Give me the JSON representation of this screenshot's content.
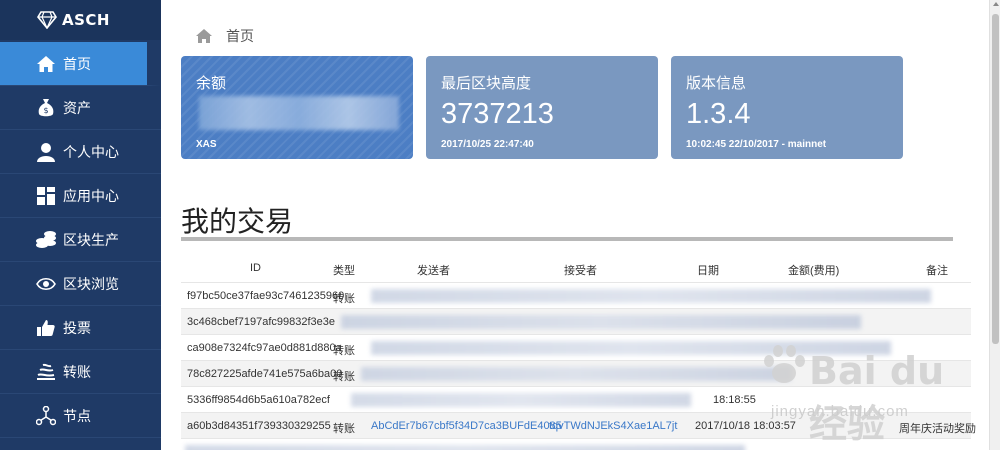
{
  "brand": {
    "name": "ASCH",
    "icon": "diamond-icon"
  },
  "sidebar": {
    "items": [
      {
        "label": "首页",
        "icon": "home-icon",
        "active": true
      },
      {
        "label": "资产",
        "icon": "money-bag-icon"
      },
      {
        "label": "个人中心",
        "icon": "user-icon"
      },
      {
        "label": "应用中心",
        "icon": "apps-grid-icon"
      },
      {
        "label": "区块生产",
        "icon": "coins-stack-icon"
      },
      {
        "label": "区块浏览",
        "icon": "eye-icon"
      },
      {
        "label": "投票",
        "icon": "thumbs-up-icon"
      },
      {
        "label": "转账",
        "icon": "transfer-icon"
      },
      {
        "label": "节点",
        "icon": "nodes-icon"
      }
    ]
  },
  "breadcrumb": {
    "label": "首页"
  },
  "cards": {
    "balance": {
      "title": "余额",
      "unit": "XAS"
    },
    "height": {
      "title": "最后区块高度",
      "value": "3737213",
      "sub": "2017/10/25 22:47:40"
    },
    "version": {
      "title": "版本信息",
      "value": "1.3.4",
      "sub": "10:02:45 22/10/2017 - mainnet"
    }
  },
  "transactions": {
    "title": "我的交易",
    "columns": [
      "ID",
      "类型",
      "发送者",
      "接受者",
      "日期",
      "金额(费用)",
      "备注"
    ],
    "rows": [
      {
        "id": "f97bc50ce37fae93c7461235960",
        "type": "转账",
        "sender": "",
        "receiver": "",
        "date": "",
        "amount": "",
        "note": ""
      },
      {
        "id": "3c468cbef7197afc99832f3e3e",
        "type": "",
        "sender": "",
        "receiver": "",
        "date": "",
        "amount": "",
        "note": ""
      },
      {
        "id": "ca908e7324fc97ae0d881d880a",
        "type": "转账",
        "sender": "",
        "receiver": "",
        "date": "",
        "amount": "",
        "note": ""
      },
      {
        "id": "78c827225afde741e575a6ba00",
        "type": "转账",
        "sender": "",
        "receiver": "",
        "date": "",
        "amount": "",
        "note": ""
      },
      {
        "id": "5336ff9854d6b5a610a782ecf",
        "type": "",
        "sender": "",
        "receiver": "",
        "date": "18:18:55",
        "amount": "",
        "note": ""
      },
      {
        "id": "a60b3d84351f739330329255",
        "type": "转账",
        "sender": "AbCdEr7b67cbf5f34D7ca3BUFdE4085",
        "receiver": "tqvTWdNJEkS4Xae1AL7jt",
        "date": "2017/10/18 18:03:57",
        "amount": "",
        "note": "周年庆活动奖励"
      }
    ]
  },
  "watermark": {
    "brand": "Bai du 经验",
    "url": "jingyan.baidu.com"
  }
}
